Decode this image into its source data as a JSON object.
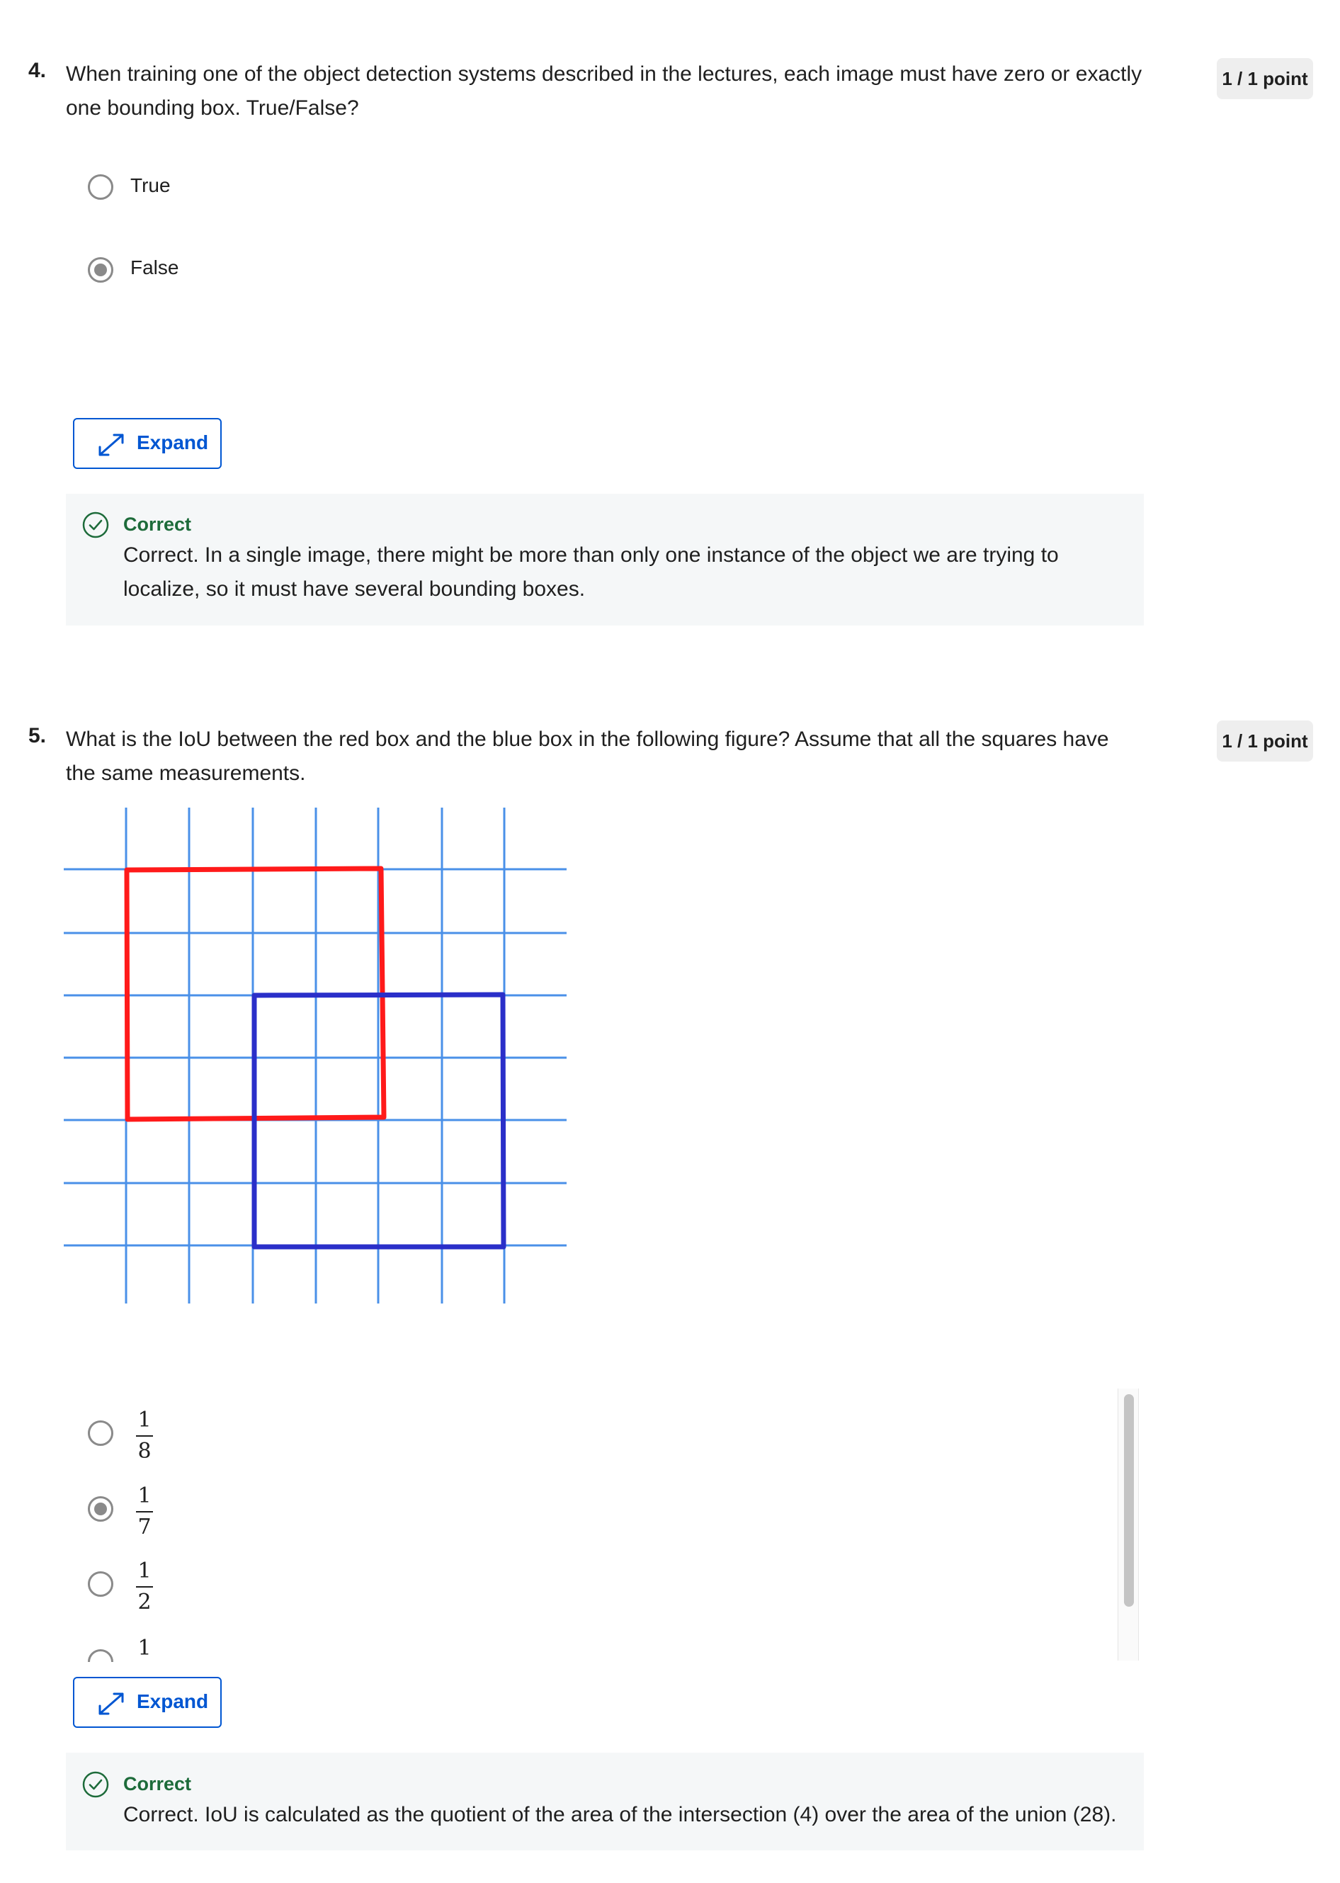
{
  "questions": [
    {
      "number": "4.",
      "text_line1": "When training one of the object detection systems described in the lectures, each image must have zero or exactly",
      "text_line2": "one bounding box. True/False?",
      "points": "1 / 1 point",
      "options": [
        {
          "label": "True",
          "selected": false
        },
        {
          "label": "False",
          "selected": true
        }
      ],
      "expand_label": "Expand",
      "feedback": {
        "title": "Correct",
        "body_line1": "Correct. In a single image, there might be more than only one instance of the object we are trying to",
        "body_line2": "localize, so it must have several bounding boxes."
      }
    },
    {
      "number": "5.",
      "text_line1": "What is the IoU between the red box and the blue box in the following figure? Assume that all the squares have",
      "text_line2": "the same measurements.",
      "points": "1 / 1 point",
      "options": [
        {
          "numerator": "1",
          "denominator": "8",
          "selected": false
        },
        {
          "numerator": "1",
          "denominator": "7",
          "selected": true
        },
        {
          "numerator": "1",
          "denominator": "2",
          "selected": false
        },
        {
          "value": "1",
          "selected": false
        }
      ],
      "expand_label": "Expand",
      "feedback": {
        "title": "Correct",
        "body": "Correct. IoU is calculated as the quotient of the area of the intersection (4) over the area of the union (28)."
      }
    }
  ],
  "figure": {
    "grid_color": "#4a90e8",
    "red_box_color": "#ff1a1a",
    "blue_box_color": "#2a2fc9"
  },
  "colors": {
    "accent": "#0056d2",
    "correct": "#1d6b3a",
    "feedback_bg": "#f5f7f8"
  }
}
